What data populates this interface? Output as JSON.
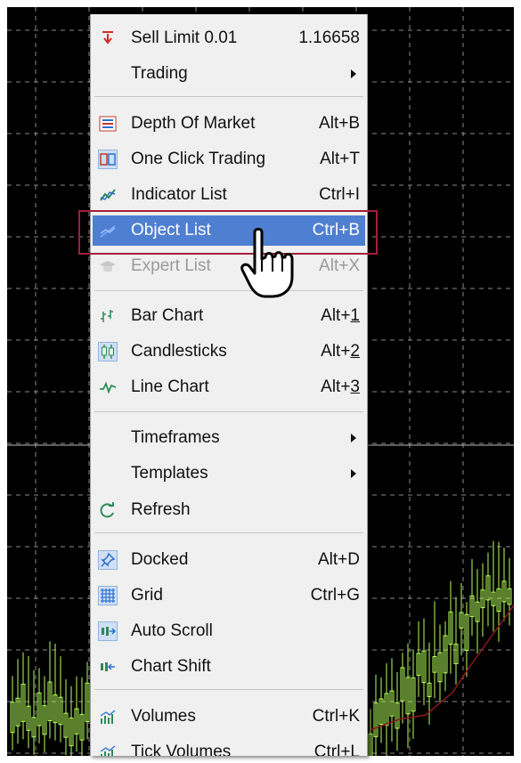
{
  "colors": {
    "menu_bg": "#f0f0f0",
    "highlight": "#4f7fd0",
    "focus_border": "#a21f3a",
    "chart_bg": "#000000",
    "candle": "#b6ff5a",
    "ma_line": "#8b1a1a"
  },
  "menu": {
    "sell_limit": {
      "label": "Sell Limit 0.01",
      "value": "1.16658",
      "icon": "down-arrow-icon"
    },
    "trading": {
      "label": "Trading"
    },
    "depth_of_market": {
      "label": "Depth Of Market",
      "shortcut": "Alt+B",
      "icon": "depth-of-market-icon"
    },
    "one_click_trading": {
      "label": "One Click Trading",
      "shortcut": "Alt+T",
      "icon": "one-click-trading-icon"
    },
    "indicator_list": {
      "label": "Indicator List",
      "shortcut": "Ctrl+I",
      "icon": "indicator-icon"
    },
    "object_list": {
      "label": "Object List",
      "shortcut": "Ctrl+B",
      "icon": "object-list-icon"
    },
    "expert_list": {
      "label": "Expert List",
      "shortcut": "Alt+X",
      "icon": "graduation-cap-icon"
    },
    "bar_chart": {
      "label": "Bar Chart",
      "shortcut_prefix": "Alt+",
      "shortcut_key": "1",
      "icon": "bar-chart-icon"
    },
    "candlesticks": {
      "label": "Candlesticks",
      "shortcut_prefix": "Alt+",
      "shortcut_key": "2",
      "icon": "candlestick-icon"
    },
    "line_chart": {
      "label": "Line Chart",
      "shortcut_prefix": "Alt+",
      "shortcut_key": "3",
      "icon": "line-chart-icon"
    },
    "timeframes": {
      "label": "Timeframes"
    },
    "templates": {
      "label": "Templates"
    },
    "refresh": {
      "label": "Refresh",
      "icon": "refresh-icon"
    },
    "docked": {
      "label": "Docked",
      "shortcut": "Alt+D",
      "icon": "pin-icon"
    },
    "grid": {
      "label": "Grid",
      "shortcut": "Ctrl+G",
      "icon": "grid-icon"
    },
    "auto_scroll": {
      "label": "Auto Scroll",
      "icon": "auto-scroll-icon"
    },
    "chart_shift": {
      "label": "Chart Shift",
      "icon": "chart-shift-icon"
    },
    "volumes": {
      "label": "Volumes",
      "shortcut": "Ctrl+K",
      "icon": "volumes-icon"
    },
    "tick_volumes": {
      "label": "Tick Volumes",
      "shortcut": "Ctrl+L",
      "icon": "tick-volumes-icon"
    }
  }
}
